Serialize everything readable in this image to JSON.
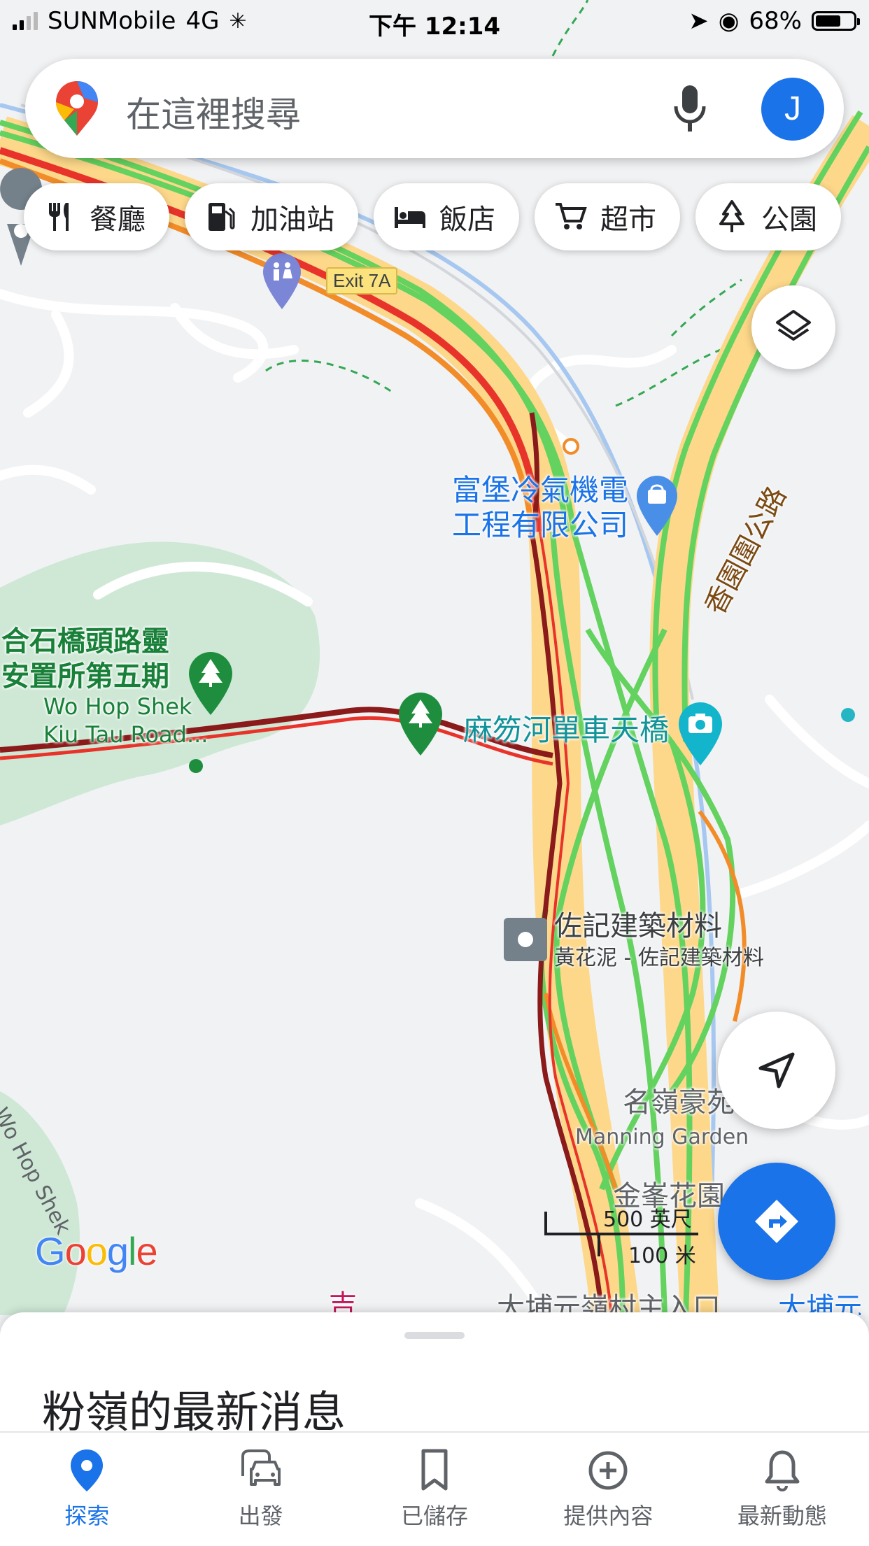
{
  "status_bar": {
    "carrier": "SUNMobile",
    "network": "4G",
    "time": "下午 12:14",
    "battery_percent": "68%",
    "battery_level": 0.68
  },
  "search": {
    "placeholder": "在這裡搜尋",
    "avatar_initial": "J"
  },
  "categories": [
    {
      "label": "餐廳",
      "icon": "restaurant-icon"
    },
    {
      "label": "加油站",
      "icon": "gas-station-icon"
    },
    {
      "label": "飯店",
      "icon": "hotel-icon"
    },
    {
      "label": "超市",
      "icon": "shopping-cart-icon"
    },
    {
      "label": "公園",
      "icon": "park-icon"
    }
  ],
  "map": {
    "exit_sign": "Exit 7A",
    "poi_fubao_line1": "富堡冷氣機電",
    "poi_fubao_line2": "工程有限公司",
    "road_heung_yuen": "香園圍公路",
    "poi_wohop_line1": "合石橋頭路靈",
    "poi_wohop_line2": "安置所第五期",
    "poi_wohop_en1": "Wo Hop Shek",
    "poi_wohop_en2": "Kiu Tau Road...",
    "poi_bridge": "麻笏河單車天橋",
    "poi_materials_line1": "佐記建築材料",
    "poi_materials_line2": "黃花泥 - 佐記建築材料",
    "poi_manning_zh": "名嶺豪苑",
    "poi_manning_en": "Manning Garden",
    "poi_garden": "金峯花園",
    "road_wohop": "Wo Hop Shek",
    "bottom_partial_1": "大埔元嶺村主入口",
    "bottom_partial_2": "大埔元嶺",
    "bottom_partial_3": "大埔元",
    "scale_imperial": "500 英尺",
    "scale_metric": "100 米",
    "logo": "Google"
  },
  "sheet": {
    "title": "粉嶺的最新消息"
  },
  "nav": [
    {
      "label": "探索",
      "icon": "explore-pin-icon",
      "active": true
    },
    {
      "label": "出發",
      "icon": "commute-icon",
      "active": false
    },
    {
      "label": "已儲存",
      "icon": "bookmark-icon",
      "active": false
    },
    {
      "label": "提供內容",
      "icon": "add-circle-icon",
      "active": false
    },
    {
      "label": "最新動態",
      "icon": "bell-icon",
      "active": false
    }
  ],
  "colors": {
    "accent": "#1a73e8",
    "traffic_green": "#63d25f",
    "traffic_orange": "#f28c28",
    "traffic_red": "#e8332a",
    "traffic_darkred": "#8b1a1a",
    "highway_fill": "#fdd88a",
    "park_green": "#c9e7d2"
  }
}
